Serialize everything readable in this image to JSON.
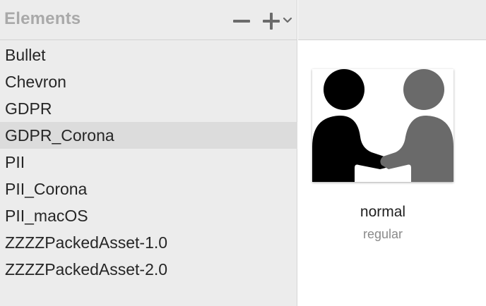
{
  "sidebar": {
    "title": "Elements",
    "items": [
      {
        "label": "Bullet",
        "selected": false
      },
      {
        "label": "Chevron",
        "selected": false
      },
      {
        "label": "GDPR",
        "selected": false
      },
      {
        "label": "GDPR_Corona",
        "selected": true
      },
      {
        "label": "PII",
        "selected": false
      },
      {
        "label": "PII_Corona",
        "selected": false
      },
      {
        "label": "PII_macOS",
        "selected": false
      },
      {
        "label": "ZZZZPackedAsset-1.0",
        "selected": false
      },
      {
        "label": "ZZZZPackedAsset-2.0",
        "selected": false
      }
    ]
  },
  "toolbar": {
    "remove_icon": "minus-icon",
    "add_icon": "plus-icon",
    "add_menu_icon": "chevron-down-icon"
  },
  "preview": {
    "image_icon": "handshake-icon",
    "appearance": "normal",
    "weight": "regular"
  }
}
